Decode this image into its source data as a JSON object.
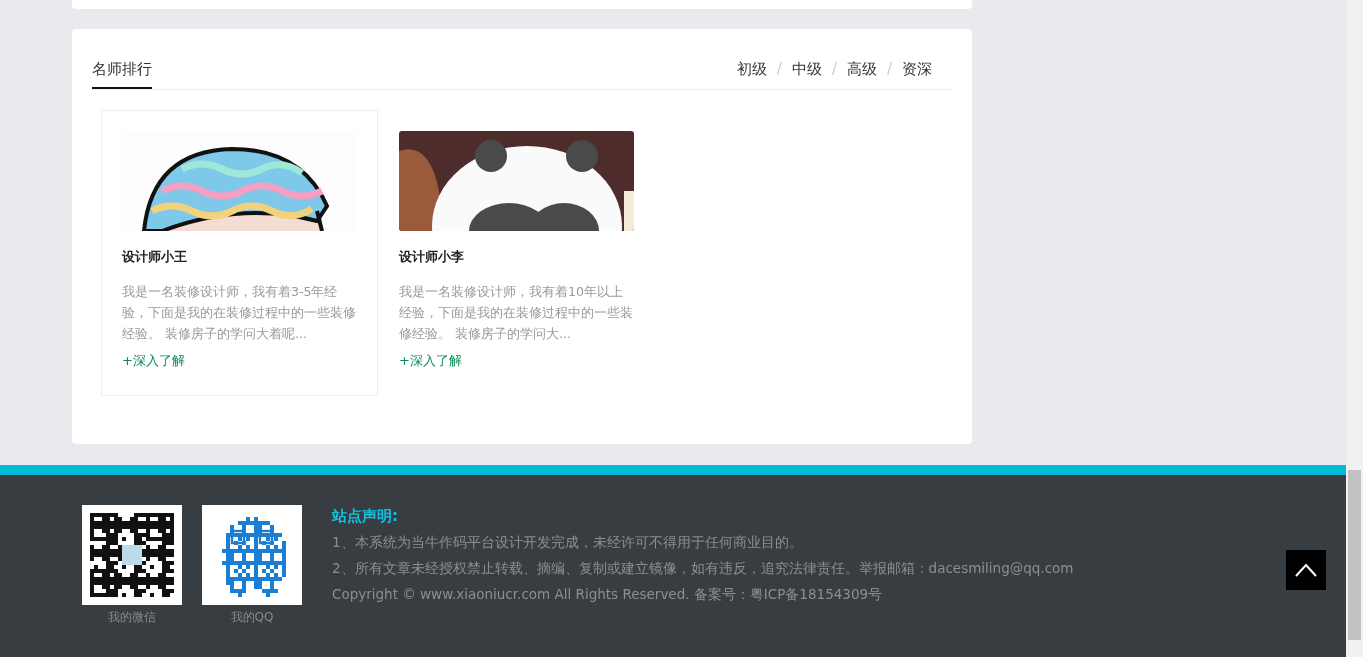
{
  "section": {
    "title": "名师排行",
    "filters": [
      {
        "label": "初级",
        "separator": "/"
      },
      {
        "label": "中级",
        "separator": "/"
      },
      {
        "label": "高级",
        "separator": "/"
      },
      {
        "label": "资深"
      }
    ]
  },
  "designers": [
    {
      "name": "设计师小王",
      "bio": "我是一名装修设计师，我有着3-5年经验，下面是我的在装修过程中的一些装修经验。 装修房子的学问大着呢...",
      "link": "+深入了解",
      "highlighted": true
    },
    {
      "name": "设计师小李",
      "bio": "我是一名装修设计师，我有着10年以上经验，下面是我的在装修过程中的一些装修经验。 装修房子的学问大...",
      "link": "+深入了解",
      "highlighted": false
    }
  ],
  "footer": {
    "qr_codes": [
      {
        "caption": "我的微信",
        "kind": "square"
      },
      {
        "caption": "我的QQ",
        "kind": "penguin"
      }
    ],
    "notice_title": "站点声明:",
    "notice_lines": [
      "1、本系统为当牛作码平台设计开发完成，未经许可不得用于任何商业目的。",
      "2、所有文章未经授权禁止转载、摘编、复制或建立镜像，如有违反，追究法律责任。举报邮箱：dacesmiling@qq.com",
      "Copyright © www.xiaoniucr.com All Rights Reserved. 备案号：粤ICP备18154309号"
    ]
  }
}
